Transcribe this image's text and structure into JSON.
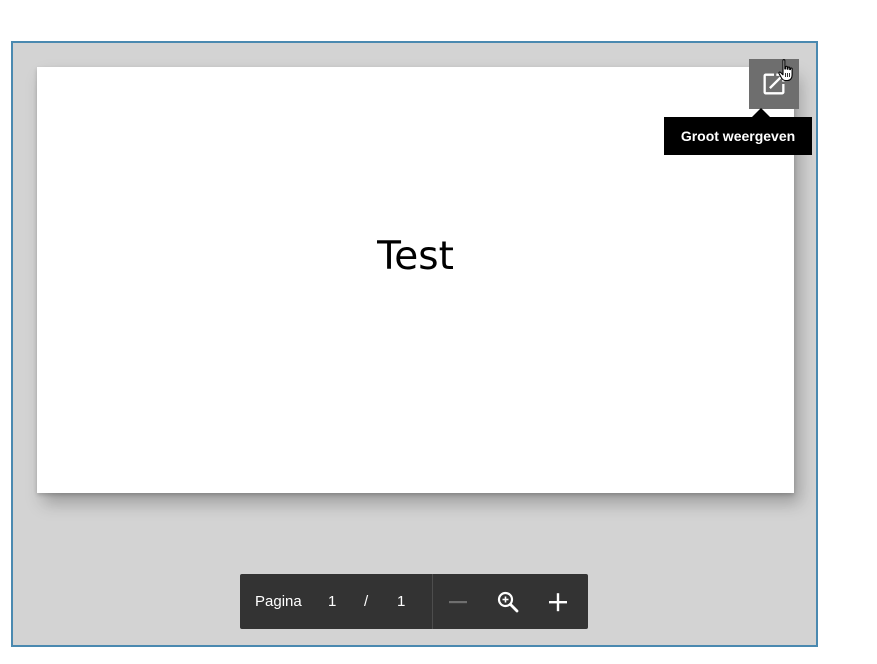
{
  "document": {
    "page_text": "Test"
  },
  "actions": {
    "open_large_icon": "open-in-new-icon",
    "tooltip": "Groot weergeven"
  },
  "toolbar": {
    "page_label": "Pagina",
    "current_page": "1",
    "separator": "/",
    "total_pages": "1",
    "zoom_out_icon": "minus-icon",
    "zoom_icon": "magnifier-icon",
    "zoom_in_icon": "plus-icon"
  },
  "colors": {
    "frame_border": "#4a89b0",
    "viewer_background": "#d3d3d3",
    "toolbar_background": "#333333",
    "tooltip_background": "#000000",
    "action_button_background": "#6e6e6e"
  }
}
